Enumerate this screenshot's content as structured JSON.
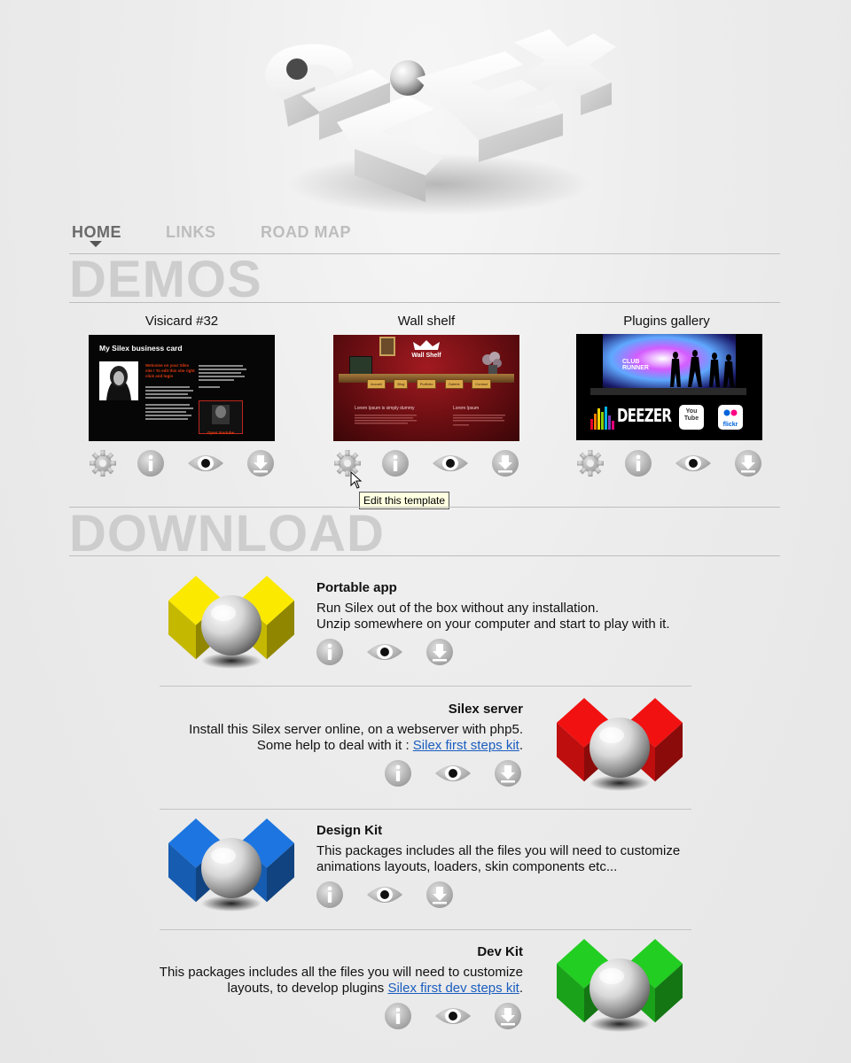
{
  "nav": {
    "items": [
      {
        "label": "HOME",
        "active": true
      },
      {
        "label": "LINKS",
        "active": false
      },
      {
        "label": "ROAD MAP",
        "active": false
      }
    ]
  },
  "sections": {
    "demos": "DEMOS",
    "download": "DOWNLOAD"
  },
  "demos": [
    {
      "title": "Visicard #32",
      "thumb_heading": "My Silex business card",
      "thumb_subtext": "Welcome on your Silex site ! To edit this site right click and login",
      "thumb_badge": "Open Youtube"
    },
    {
      "title": "Wall shelf",
      "thumb_heading": "Wall Shelf",
      "thumb_menu": [
        "Accueil",
        "Blog",
        "Portfolio",
        "Galerie",
        "Contact"
      ],
      "thumb_col1": "Lorem Ipsum is simply dummy",
      "thumb_col2": "Lorem Ipsum"
    },
    {
      "title": "Plugins gallery",
      "thumb_heading": "CLUB RUNNER",
      "thumb_logos": [
        "DEEZER",
        "You Tube",
        "flickr"
      ]
    }
  ],
  "demo_icons": [
    "gear-icon",
    "info-icon",
    "eye-icon",
    "download-icon"
  ],
  "tooltip": "Edit this template",
  "downloads": [
    {
      "title": "Portable app",
      "lines": [
        "Run Silex out of the box without any installation.",
        "Unzip somewhere on your computer and start to play with it."
      ],
      "color": "#e8d800"
    },
    {
      "title": "Silex server",
      "line1": "Install  this Silex server online, on a webserver with php5.",
      "line2_pre": "Some help to deal with it : ",
      "line2_link": "Silex first steps kit",
      "line2_post": ".",
      "color": "#e01010"
    },
    {
      "title": "Design Kit",
      "lines": [
        "This packages includes all the files you will need to customize",
        "animations layouts, loaders, skin components etc..."
      ],
      "color": "#1a6ccf"
    },
    {
      "title": "Dev Kit",
      "line1": "This packages includes all the files you will need to customize",
      "line2_pre": "layouts, to develop plugins ",
      "line2_link": "Silex first dev steps kit",
      "line2_post": ".",
      "color": "#1fbf1f"
    }
  ],
  "dl_icons": [
    "info-icon",
    "eye-icon",
    "download-icon"
  ]
}
